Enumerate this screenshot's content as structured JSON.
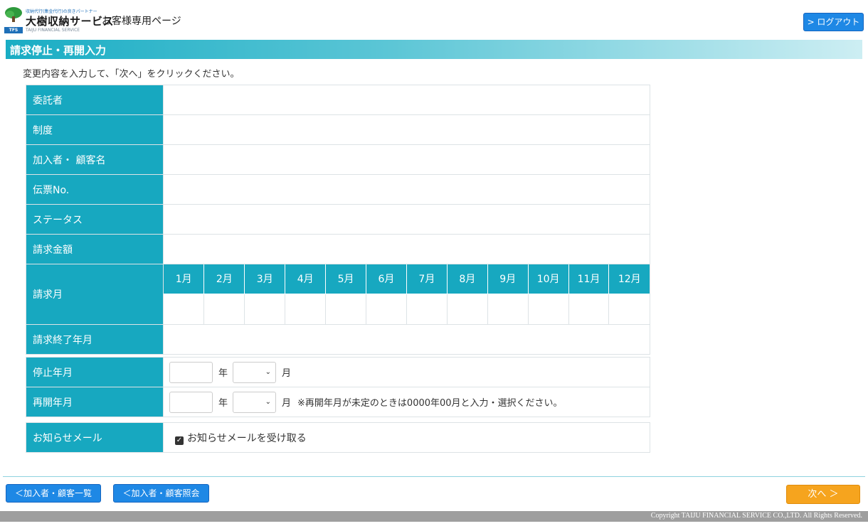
{
  "header": {
    "logo_tagline": "収納代行(集金代行)の良きパートナー",
    "logo_name": "大樹収納サービス",
    "logo_sub": "TAIJU FINANCIAL SERVICE",
    "logo_badge": "TFS",
    "page_label": "お客様専用ページ",
    "logout_label": "> ログアウト"
  },
  "page": {
    "title": "請求停止・再開入力",
    "instruction": "変更内容を入力して、「次へ」をクリックください。"
  },
  "info": {
    "consignor": {
      "label": "委託者",
      "value": ""
    },
    "system": {
      "label": "制度",
      "value": ""
    },
    "customer_name": {
      "label": "加入者・ 顧客名",
      "value": ""
    },
    "slip_no": {
      "label": "伝票No.",
      "value": ""
    },
    "status": {
      "label": "ステータス",
      "value": ""
    },
    "amount": {
      "label": "請求金額",
      "value": ""
    },
    "billing_month": {
      "label": "請求月",
      "months": [
        "1月",
        "2月",
        "3月",
        "4月",
        "5月",
        "6月",
        "7月",
        "8月",
        "9月",
        "10月",
        "11月",
        "12月"
      ]
    },
    "end_month": {
      "label": "請求終了年月",
      "value": ""
    }
  },
  "form": {
    "stop": {
      "label": "停止年月",
      "year_value": "",
      "year_unit": "年",
      "month_value": "",
      "month_unit": "月"
    },
    "resume": {
      "label": "再開年月",
      "year_value": "",
      "year_unit": "年",
      "month_value": "",
      "month_unit": "月",
      "note": "※再開年月が未定のときは0000年00月と入力・選択ください。"
    },
    "mail": {
      "label": "お知らせメール",
      "checkbox_label": "お知らせメールを受け取る",
      "checked": true
    }
  },
  "buttons": {
    "list": "＜加入者・顧客一覧",
    "ref": "＜加入者・顧客照会",
    "next": "次へ ＞"
  },
  "footer": {
    "copyright": "Copyright TAIJU FINANCIAL SERVICE CO.,LTD. All Rights Reserved."
  },
  "colors": {
    "accent": "#17a8c0",
    "button_blue": "#1e88e5",
    "button_orange": "#f6a41e",
    "footer": "#9e9e9e"
  }
}
